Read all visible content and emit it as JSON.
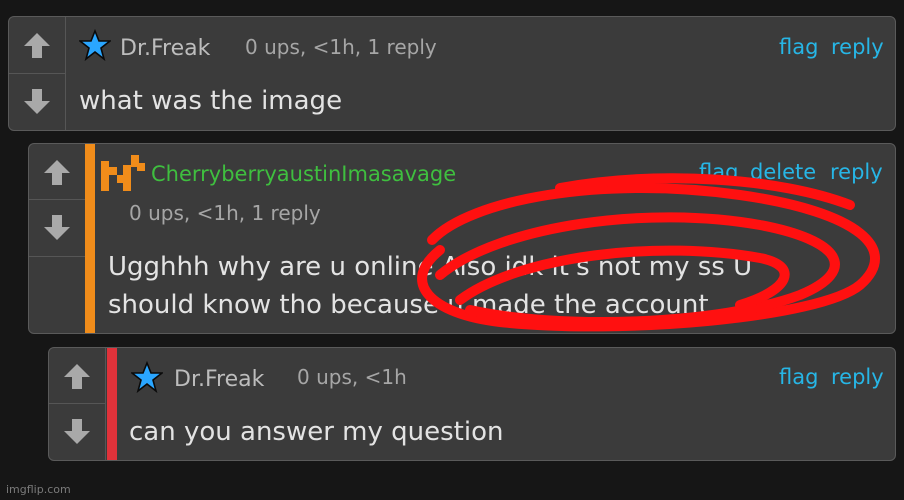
{
  "comments": [
    {
      "username": "Dr.Freak",
      "meta": "0 ups, <1h, 1 reply",
      "text": "what was the image",
      "actions": {
        "flag": "flag",
        "reply": "reply"
      }
    },
    {
      "username": "CherryberryaustinImasavage",
      "meta": "0 ups, <1h, 1 reply",
      "text_line1": "Ugghhh why are u online Also idk it's not my ss U",
      "text_line2": "should know tho because u made the account",
      "actions": {
        "flag": "flag",
        "delete": "delete",
        "reply": "reply"
      }
    },
    {
      "username": "Dr.Freak",
      "meta": "0 ups, <1h",
      "text": "can you answer my question",
      "actions": {
        "flag": "flag",
        "reply": "reply"
      }
    }
  ],
  "watermark": "imgflip.com",
  "colors": {
    "background": "#161616",
    "card": "#3b3b3b",
    "link": "#27b6e6",
    "reply_bar_orange": "#f08c1a",
    "reply_bar_red": "#e0323a",
    "scribble": "#ff1010"
  },
  "icons": [
    "arrow-up-icon",
    "arrow-down-icon",
    "star-icon",
    "pixel-avatar-icon"
  ]
}
